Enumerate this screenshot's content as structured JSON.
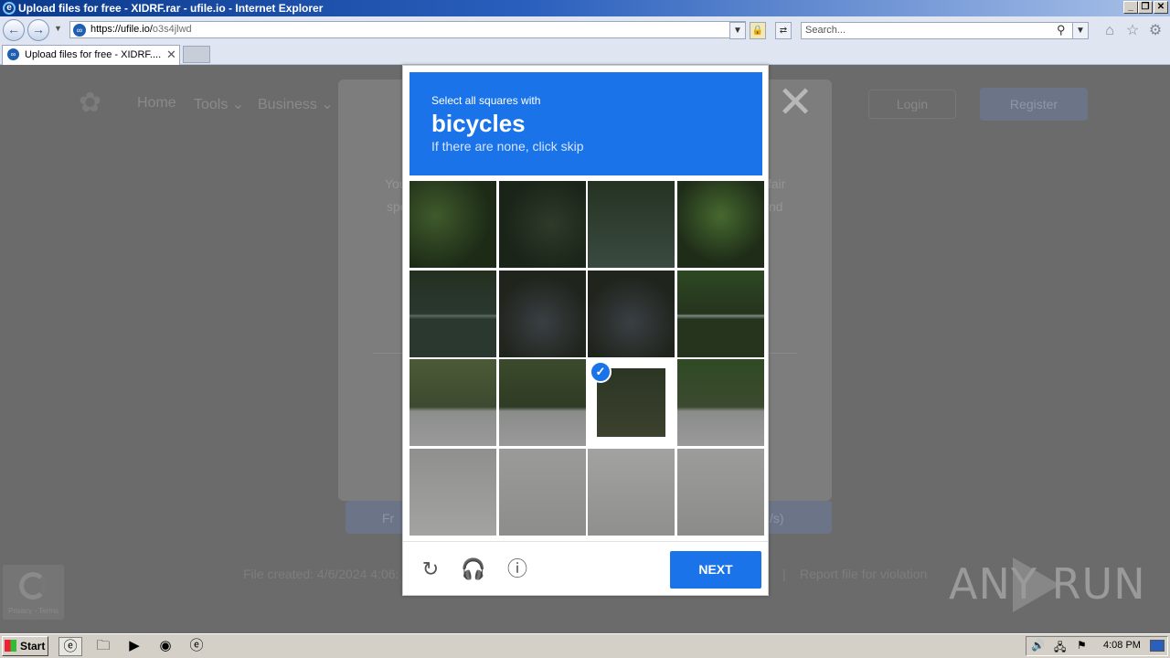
{
  "window": {
    "title": "Upload files for free - XIDRF.rar - ufile.io - Internet Explorer"
  },
  "addressbar": {
    "url_host": "https://ufile.io/",
    "url_path": "o3s4jlwd",
    "search_placeholder": "Search..."
  },
  "tab": {
    "label": "Upload files for free - XIDRF...."
  },
  "site": {
    "nav": [
      {
        "label": "Home"
      },
      {
        "label": "Tools"
      },
      {
        "label": "Business"
      }
    ],
    "login": "Login",
    "register": "Register",
    "modal_text_left1": "You",
    "modal_text_right1": "fair",
    "modal_text_left2": "spe",
    "modal_text_right2": "nd",
    "free_btn_fragment": "Fr",
    "speed_fragment": "/s)",
    "file_created": "File created: 4/6/2024 4:06:",
    "separator": "|",
    "report_link": "Report file for violation",
    "recaptcha_badge": "Privacy - Terms"
  },
  "captcha": {
    "instruction": "Select all squares with",
    "target": "bicycles",
    "hint": "If there are none, click skip",
    "next_label": "NEXT",
    "selected_tiles": [
      10
    ]
  },
  "watermark": {
    "text": "ANY RUN"
  },
  "taskbar": {
    "start": "Start",
    "clock": "4:08 PM"
  },
  "colors": {
    "captcha_blue": "#1a73e8",
    "dim_overlay": "#6b6b6b"
  }
}
